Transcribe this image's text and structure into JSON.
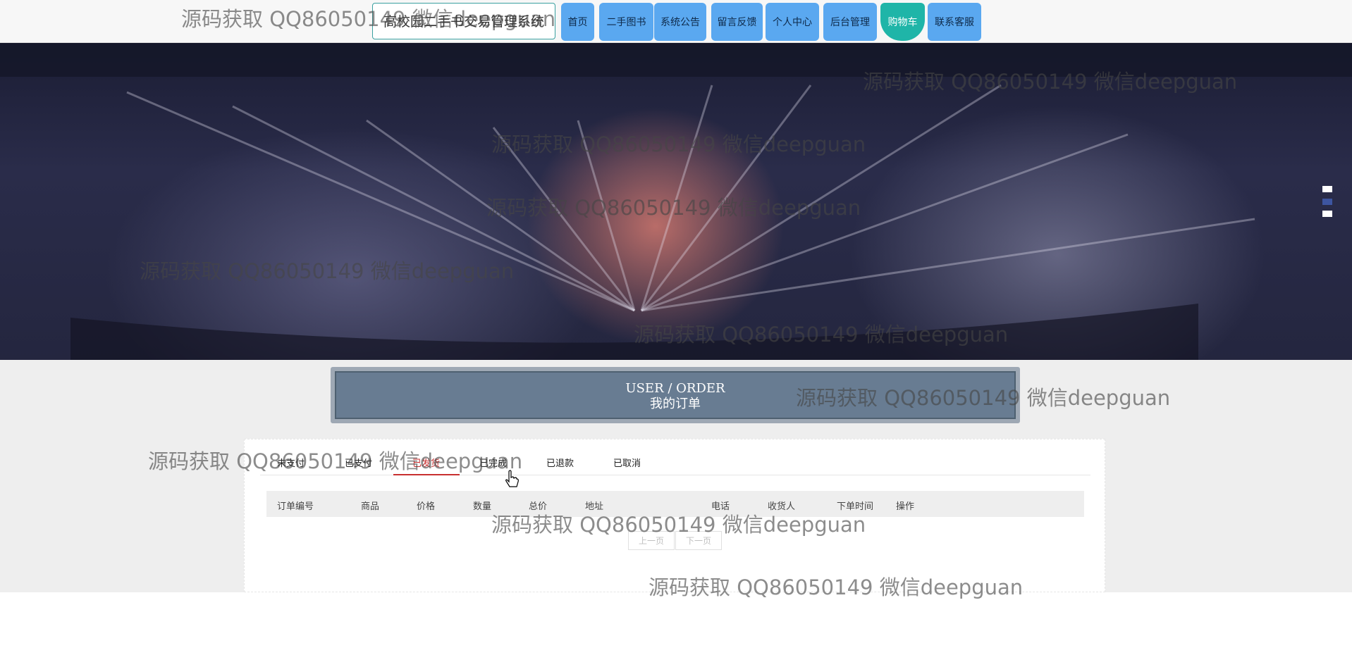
{
  "header": {
    "site_title": "高校园二手书交易管理系统",
    "nav": [
      {
        "label": "首页"
      },
      {
        "label": "二手图书"
      },
      {
        "label": "系统公告"
      },
      {
        "label": "留言反馈"
      },
      {
        "label": "个人中心"
      },
      {
        "label": "后台管理"
      },
      {
        "label": "购物车",
        "active": true
      },
      {
        "label": "联系客服"
      }
    ]
  },
  "banner": {
    "slides": 3,
    "active_slide": 2
  },
  "order_section": {
    "title_en": "USER / ORDER",
    "title_cn": "我的订单"
  },
  "tabs": [
    "未支付",
    "已支付",
    "已发货",
    "已完成",
    "已退款",
    "已取消"
  ],
  "active_tab": "已发货",
  "table": {
    "columns": [
      "订单编号",
      "商品",
      "价格",
      "数量",
      "总价",
      "地址",
      "电话",
      "收货人",
      "下单时间",
      "操作"
    ],
    "rows": []
  },
  "pagination": {
    "prev": "上一页",
    "next": "下一页"
  },
  "watermark": "源码获取 QQ86050149 微信deepguan",
  "colors": {
    "nav_button": "#5aa8f0",
    "nav_active": "#1fb5a8",
    "order_header_bg": "#687c92",
    "tab_active_underline": "#c83030"
  }
}
